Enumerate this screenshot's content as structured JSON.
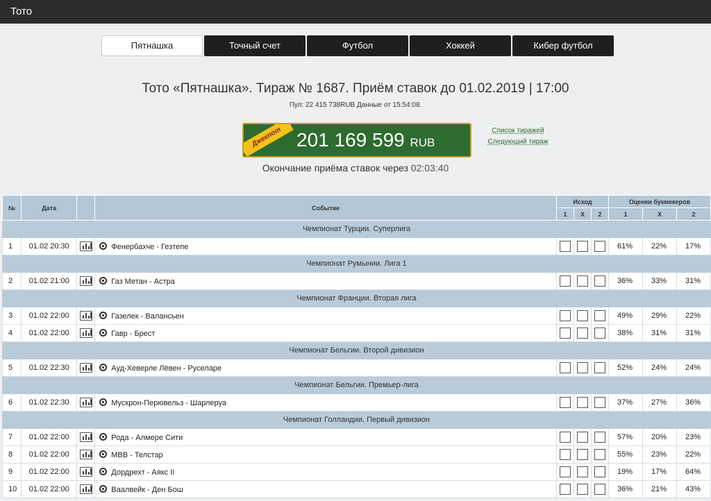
{
  "header": {
    "title": "Тото"
  },
  "tabs": [
    {
      "label": "Пятнашка",
      "active": true
    },
    {
      "label": "Точный счет",
      "active": false
    },
    {
      "label": "Футбол",
      "active": false
    },
    {
      "label": "Хоккей",
      "active": false
    },
    {
      "label": "Кибер футбол",
      "active": false
    }
  ],
  "draw": {
    "title": "Тото «Пятнашка». Тираж № 1687. Приём ставок до 01.02.2019 | 17:00",
    "pool": "Пул: 22 415 738RUB Данные от 15:54:08.",
    "jackpot_label": "Джекпот",
    "jackpot_amount": "201 169 599",
    "jackpot_currency": "RUB",
    "links": {
      "draw_list": "Список тиражей",
      "next_draw": "Следующий тираж"
    },
    "countdown_label": "Окончание приёма ставок через",
    "countdown_time": "02:03:40"
  },
  "table": {
    "headers": {
      "num": "№",
      "date": "Дата",
      "event": "Событие",
      "outcome": "Исход",
      "bookmakers": "Оценки букмекеров",
      "o1": "1",
      "ox": "X",
      "o2": "2",
      "b1": "1",
      "bx": "X",
      "b2": "2"
    },
    "groups": [
      {
        "name": "Чемпионат Турции. Суперлига",
        "rows": [
          {
            "num": "1",
            "date": "01.02 20:30",
            "event": "Фенербахче - Гезтепе",
            "p1": "61%",
            "px": "22%",
            "p2": "17%"
          }
        ]
      },
      {
        "name": "Чемпионат Румынии. Лига 1",
        "rows": [
          {
            "num": "2",
            "date": "01.02 21:00",
            "event": "Газ Метан - Астра",
            "p1": "36%",
            "px": "33%",
            "p2": "31%"
          }
        ]
      },
      {
        "name": "Чемпионат Франции. Вторая лига",
        "rows": [
          {
            "num": "3",
            "date": "01.02 22:00",
            "event": "Газелек - Валансьен",
            "p1": "49%",
            "px": "29%",
            "p2": "22%"
          },
          {
            "num": "4",
            "date": "01.02 22:00",
            "event": "Гавр - Брест",
            "p1": "38%",
            "px": "31%",
            "p2": "31%"
          }
        ]
      },
      {
        "name": "Чемпионат Бельгии. Второй дивизион",
        "rows": [
          {
            "num": "5",
            "date": "01.02 22:30",
            "event": "Ауд-Хеверле Лёвен - Руселаре",
            "p1": "52%",
            "px": "24%",
            "p2": "24%"
          }
        ]
      },
      {
        "name": "Чемпионат Бельгии. Премьер-лига",
        "rows": [
          {
            "num": "6",
            "date": "01.02 22:30",
            "event": "Мускрон-Перювельз - Шарлеруа",
            "p1": "37%",
            "px": "27%",
            "p2": "36%"
          }
        ]
      },
      {
        "name": "Чемпионат Голландии. Первый дивизион",
        "rows": [
          {
            "num": "7",
            "date": "01.02 22:00",
            "event": "Рода - Алмере Сити",
            "p1": "57%",
            "px": "20%",
            "p2": "23%"
          },
          {
            "num": "8",
            "date": "01.02 22:00",
            "event": "МВВ - Телстар",
            "p1": "55%",
            "px": "23%",
            "p2": "22%"
          },
          {
            "num": "9",
            "date": "01.02 22:00",
            "event": "Дордрехт - Аякс II",
            "p1": "19%",
            "px": "17%",
            "p2": "64%"
          },
          {
            "num": "10",
            "date": "01.02 22:00",
            "event": "Ваалвейк - Ден Бош",
            "p1": "36%",
            "px": "21%",
            "p2": "43%"
          }
        ]
      }
    ]
  }
}
